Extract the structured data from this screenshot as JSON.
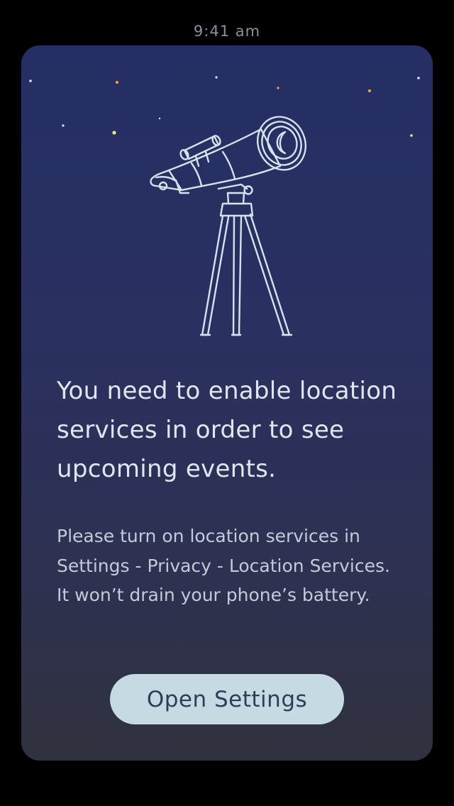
{
  "status_bar": {
    "time": "9:41 am"
  },
  "main": {
    "illustration": {
      "icon": "telescope-icon",
      "star_colors": {
        "white": "#dfe6f5",
        "orange": "#f0a65a",
        "yellow": "#f6e27a"
      }
    },
    "headline": "You need to enable location services in order to see upcoming events.",
    "body": "Please turn on location services in Settings - Privacy - Location Services. It won’t drain your phone’s battery.",
    "button_label": "Open Settings"
  },
  "colors": {
    "background": "#000000",
    "card_top": "#252f65",
    "card_bottom": "#30323f",
    "headline_text": "#dfe6ee",
    "body_text": "#c3cbd8",
    "button_background": "#c6dae3",
    "button_text": "#2e3e58",
    "status_text": "#8a8f9c"
  }
}
